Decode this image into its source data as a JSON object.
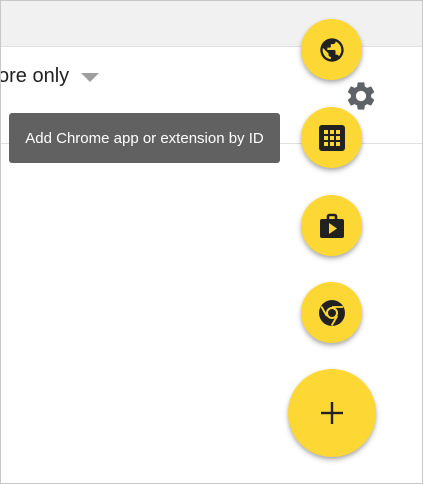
{
  "filter": {
    "label": "ore only",
    "caret_icon": "dropdown-caret-icon"
  },
  "settings": {
    "icon": "gear-icon"
  },
  "tooltip": {
    "text": "Add Chrome app or extension by ID"
  },
  "fab_menu": {
    "items": [
      {
        "icon": "globe-icon"
      },
      {
        "icon": "apps-grid-icon"
      },
      {
        "icon": "web-store-icon"
      },
      {
        "icon": "chrome-icon"
      }
    ],
    "main": {
      "icon": "plus-icon"
    }
  },
  "colors": {
    "fab": "#fdd835",
    "icon": "#212121",
    "tooltip_bg": "#616161",
    "gear": "#5f6368",
    "caret": "#9e9e9e"
  }
}
